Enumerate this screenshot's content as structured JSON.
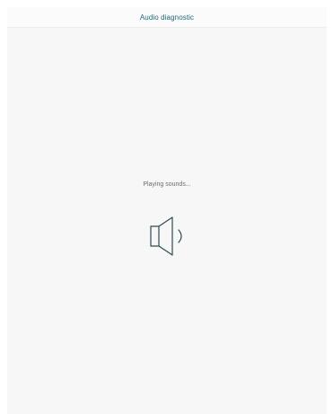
{
  "header": {
    "title": "Audio diagnostic"
  },
  "main": {
    "status_text": "Playing sounds...",
    "icon": "speaker-icon"
  },
  "colors": {
    "title": "#1f6677",
    "status_text": "#6b6b6b",
    "icon_stroke": "#2f4b53",
    "panel_background": "#f7f7f7"
  }
}
